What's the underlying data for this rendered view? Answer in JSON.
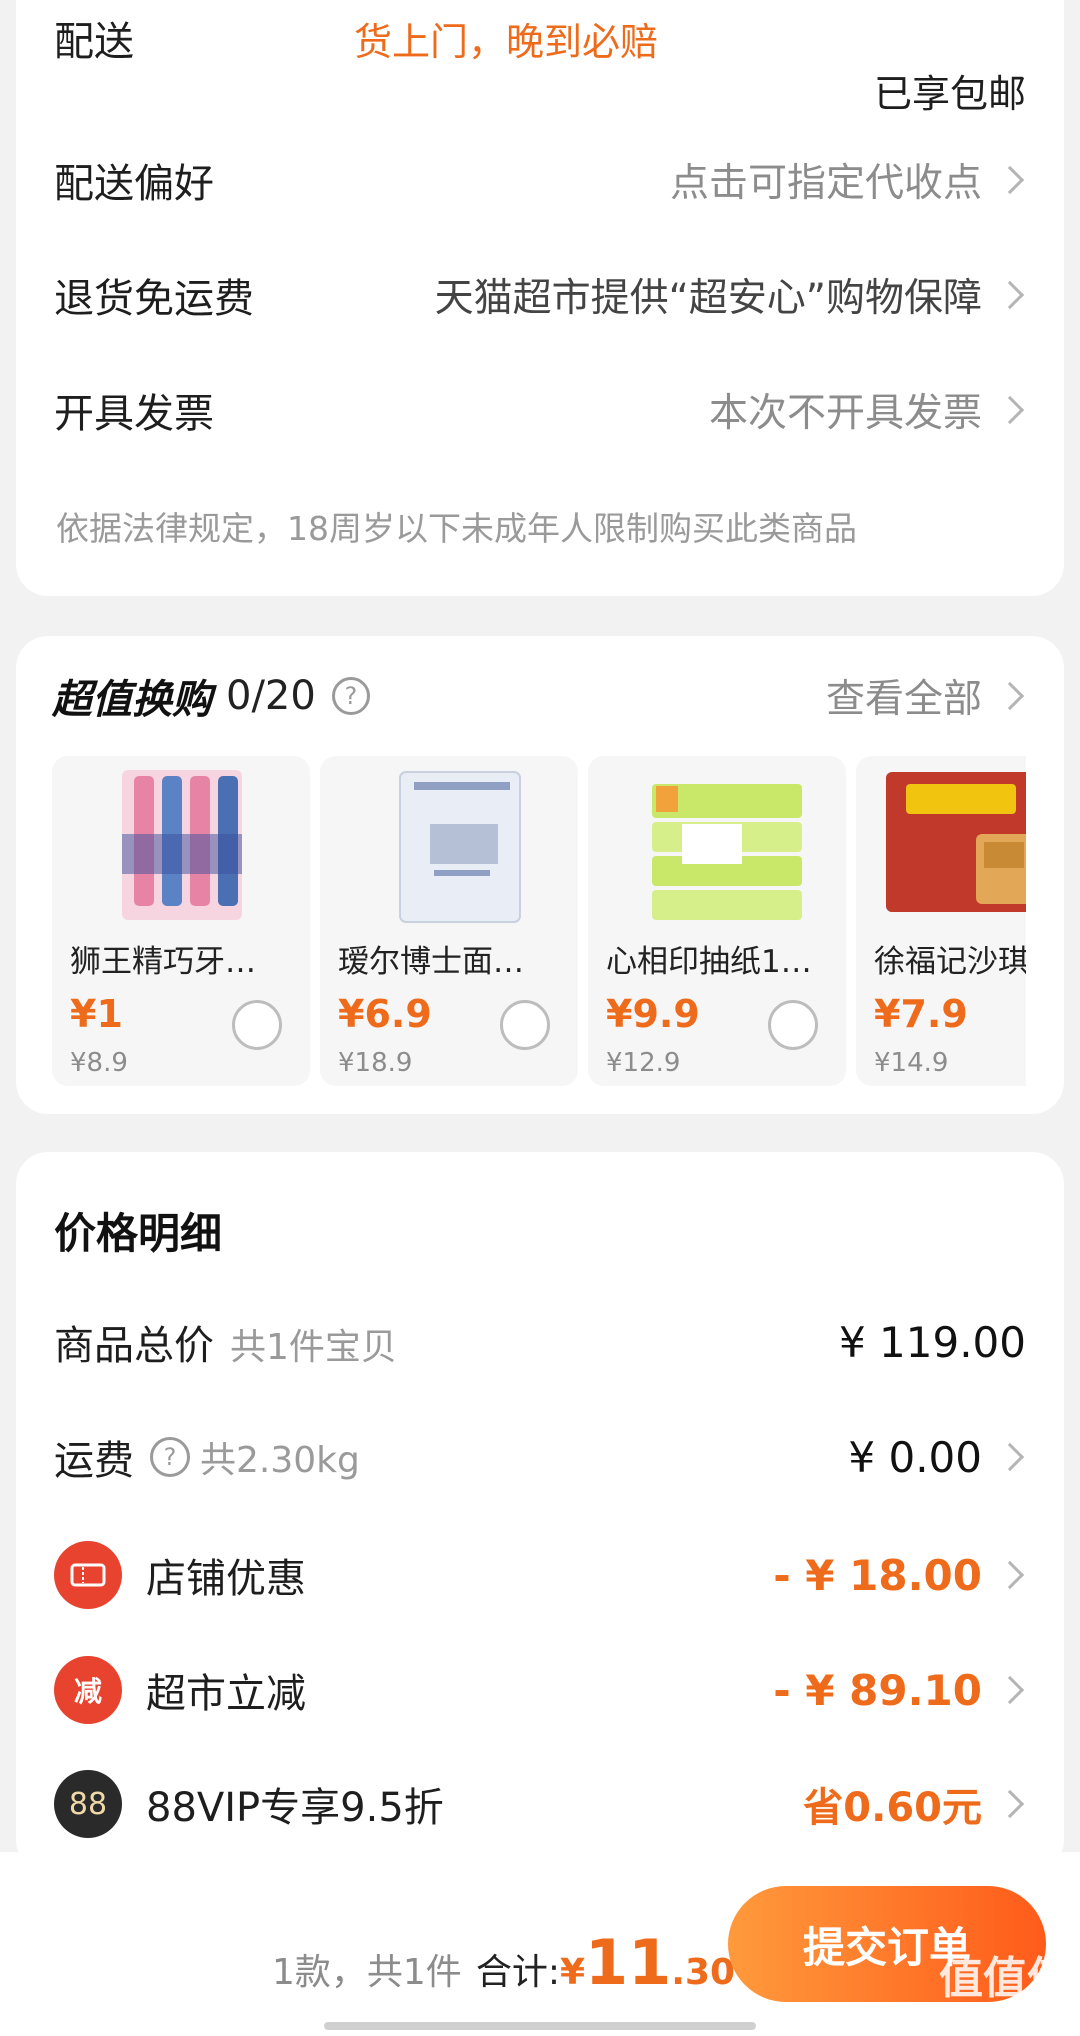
{
  "delivery": {
    "label": "配送",
    "promo": "货上门，晚到必赔",
    "free_shipping": "已享包邮"
  },
  "options": [
    {
      "label": "配送偏好",
      "value": "点击可指定代收点"
    },
    {
      "label": "退货免运费",
      "value": "天猫超市提供“超安心”购物保障"
    },
    {
      "label": "开具发票",
      "value": "本次不开具发票"
    }
  ],
  "legal_notice": "依据法律规定，18周岁以下未成年人限制购买此类商品",
  "swap": {
    "title": "超值换购",
    "count": "0/20",
    "help_icon": "question-icon",
    "view_all": "查看全部",
    "items": [
      {
        "name": "狮王精巧牙…",
        "price": "¥1",
        "orig": "¥8.9",
        "icon": "toothbrush-product-image"
      },
      {
        "name": "瑷尔博士面…",
        "price": "¥6.9",
        "orig": "¥18.9",
        "icon": "face-mask-product-image"
      },
      {
        "name": "心相印抽纸1…",
        "price": "¥9.9",
        "orig": "¥12.9",
        "icon": "tissue-product-image"
      },
      {
        "name": "徐福记沙琪",
        "price": "¥7.9",
        "orig": "¥14.9",
        "icon": "snack-product-image"
      }
    ]
  },
  "price_detail": {
    "title": "价格明细",
    "goods_total": {
      "label": "商品总价",
      "sub": "共1件宝贝",
      "value": "¥ 119.00"
    },
    "shipping": {
      "label": "运费",
      "sub": "共2.30kg",
      "value": "¥ 0.00"
    },
    "discounts": [
      {
        "label": "店铺优惠",
        "value": "- ¥ 18.00",
        "icon": "coupon-icon",
        "color": "#e8432f"
      },
      {
        "label": "超市立减",
        "value": "- ¥ 89.10",
        "icon": "reduce-icon",
        "icon_text": "减",
        "color": "#e8432f"
      },
      {
        "label": "88VIP专享9.5折",
        "value": "省0.60元",
        "icon": "vip-88-icon",
        "icon_text": "88",
        "color": "#2a2a2a"
      }
    ]
  },
  "footer": {
    "summary": "1款，共1件",
    "total_label": "合计:",
    "total_currency": "¥",
    "total_int": "11",
    "total_dec": ".30",
    "submit": "提交订单",
    "watermark": "值值值",
    "watermark_url": "zhizhizhi.com"
  },
  "colors": {
    "accent": "#ef6b1c",
    "button_start": "#ff9a3c",
    "button_end": "#ff5b1a"
  }
}
